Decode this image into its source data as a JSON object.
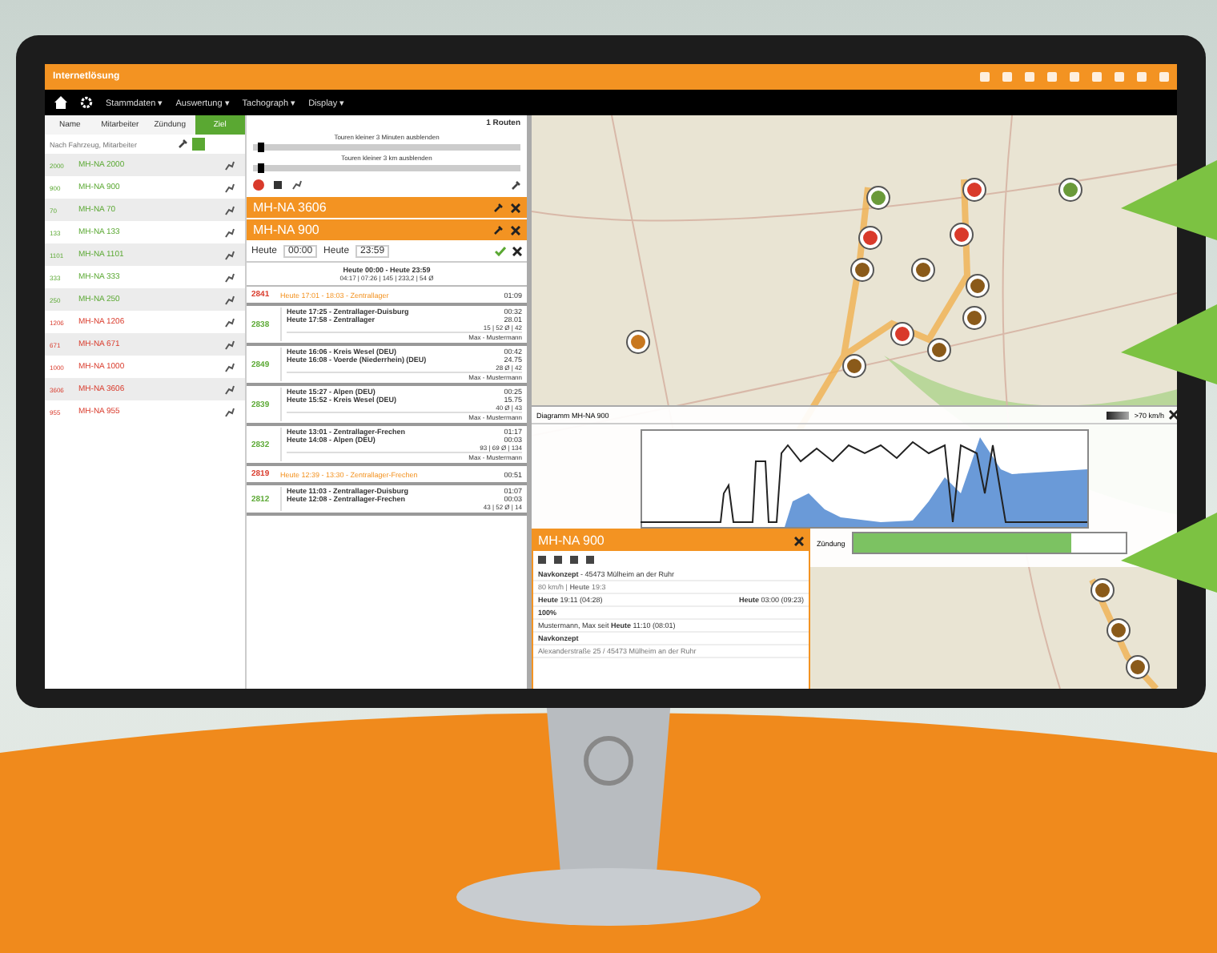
{
  "app": {
    "title": "Internetlösung"
  },
  "menu": [
    {
      "label": "Stammdaten ▾"
    },
    {
      "label": "Auswertung ▾"
    },
    {
      "label": "Tachograph ▾"
    },
    {
      "label": "Display ▾"
    }
  ],
  "vehicle_panel": {
    "tabs": [
      {
        "label": "Name",
        "selected": false
      },
      {
        "label": "Mitarbeiter",
        "selected": false
      },
      {
        "label": "Zündung",
        "selected": false
      },
      {
        "label": "Ziel",
        "selected": true
      }
    ],
    "search": {
      "placeholder": "Nach Fahrzeug, Mitarbeiter"
    },
    "vehicles": [
      {
        "code": "2000",
        "name": "MH-NA 2000",
        "color": "#5aa832"
      },
      {
        "code": "900",
        "name": "MH-NA 900",
        "color": "#5aa832"
      },
      {
        "code": "70",
        "name": "MH-NA 70",
        "color": "#5aa832"
      },
      {
        "code": "133",
        "name": "MH-NA 133",
        "color": "#5aa832"
      },
      {
        "code": "1101",
        "name": "MH-NA 1101",
        "color": "#5aa832"
      },
      {
        "code": "333",
        "name": "MH-NA 333",
        "color": "#5aa832"
      },
      {
        "code": "250",
        "name": "MH-NA 250",
        "color": "#5aa832"
      },
      {
        "code": "1206",
        "name": "MH-NA 1206",
        "color": "#d93a2b"
      },
      {
        "code": "671",
        "name": "MH-NA 671",
        "color": "#d93a2b"
      },
      {
        "code": "1000",
        "name": "MH-NA 1000",
        "color": "#d93a2b"
      },
      {
        "code": "3606",
        "name": "MH-NA 3606",
        "color": "#d93a2b"
      },
      {
        "code": "955",
        "name": "MH-NA 955",
        "color": "#d93a2b"
      }
    ]
  },
  "route_panel": {
    "header": "1 Routen",
    "filters": [
      {
        "label": "Touren kleiner 3 Minuten ausblenden",
        "level": 0.02
      },
      {
        "label": "Touren kleiner 3 km ausblenden",
        "level": 0.02
      }
    ],
    "selected_vehicles": [
      {
        "name": "MH-NA 3606"
      },
      {
        "name": "MH-NA 900"
      }
    ],
    "date_range": {
      "from_day": "Heute",
      "from_time": "00:00",
      "to_day": "Heute",
      "to_time": "23:59"
    },
    "summary": {
      "title": "Heute 00:00 - Heute 23:59",
      "stats": "04:17 | 07:26 | 145 | 233,2 | 54 Ø"
    },
    "trips": [
      {
        "kind": "stop",
        "id": "2841",
        "color": "#d93a2b",
        "line": "Heute 17:01 - 18:03 - Zentrallager",
        "value": "01:09"
      },
      {
        "kind": "trip",
        "id": "2838",
        "color": "#5aa832",
        "lines": [
          "Heute 17:25 - Zentrallager-Duisburg",
          "Heute 17:58 - Zentrallager"
        ],
        "values": [
          "00:32",
          "28.01"
        ],
        "stats": "15 | 52 Ø | 42",
        "driver": "Max - Mustermann"
      },
      {
        "kind": "trip",
        "id": "2849",
        "color": "#5aa832",
        "lines": [
          "Heute 16:06 - Kreis Wesel (DEU)",
          "Heute 16:08 - Voerde (Niederrhein) (DEU)"
        ],
        "values": [
          "00:42",
          "24.75"
        ],
        "stats": "28 Ø | 42",
        "driver": "Max - Mustermann"
      },
      {
        "kind": "trip",
        "id": "2839",
        "color": "#5aa832",
        "lines": [
          "Heute 15:27 - Alpen (DEU)",
          "Heute 15:52 - Kreis Wesel (DEU)"
        ],
        "values": [
          "00:25",
          "15.75"
        ],
        "stats": "40 Ø | 43",
        "driver": "Max - Mustermann"
      },
      {
        "kind": "trip",
        "id": "2832",
        "color": "#5aa832",
        "lines": [
          "Heute 13:01 - Zentrallager-Frechen",
          "Heute 14:08 - Alpen (DEU)"
        ],
        "values": [
          "01:17",
          "00:03"
        ],
        "stats": "93 | 69 Ø | 134",
        "driver": "Max - Mustermann"
      },
      {
        "kind": "stop",
        "id": "2819",
        "color": "#d93a2b",
        "line": "Heute 12:39 - 13:30 - Zentrallager-Frechen",
        "value": "00:51"
      },
      {
        "kind": "trip",
        "id": "2812",
        "color": "#5aa832",
        "lines": [
          "Heute 11:03 - Zentrallager-Duisburg",
          "Heute 12:08 - Zentrallager-Frechen"
        ],
        "values": [
          "01:07",
          "00:03"
        ],
        "stats": "43 | 52 Ø | 14"
      }
    ]
  },
  "chart_panel": {
    "title": "Diagramm MH-NA 900",
    "legend": ">70 km/h",
    "track_label": "Zündung"
  },
  "popup": {
    "title": "MH-NA 900",
    "place": "**Navkonzept** - 45473 Mülheim an der Ruhr",
    "speed": "80 km/h | **Heute** 19:3",
    "start": "**Heute** 19:11 (04:28)",
    "end": "**Heute** 03:00 (09:23)",
    "battery": "100%",
    "driver": "Mustermann, Max seit **Heute** 11:10 (08:01)",
    "address_title": "Navkonzept",
    "address": "Alexanderstraße 25 / 45473 Mülheim an der Ruhr"
  }
}
